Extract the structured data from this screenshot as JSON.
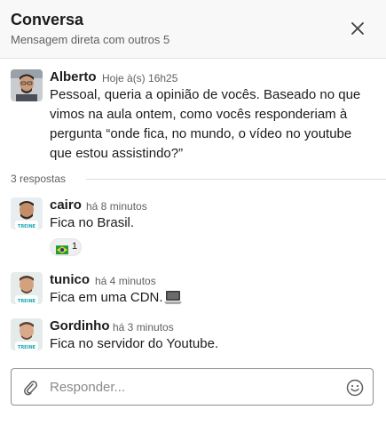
{
  "header": {
    "title": "Conversa",
    "subtitle": "Mensagem direta com outros 5",
    "close_icon": "close-icon"
  },
  "parent_message": {
    "author": "Alberto",
    "time": "Hoje à(s) 16h25",
    "text": "Pessoal, queria a opinião de vocês. Baseado no que vimos na aula ontem, como vocês responderiam à pergunta “onde fica, no mundo, o vídeo no youtube que estou assistindo?”"
  },
  "replies_label": "3 respostas",
  "replies": [
    {
      "author": "cairo",
      "time": "há 8 minutos",
      "text": "Fica no Brasil.",
      "reaction": {
        "emoji": "brazil-flag-icon",
        "count": "1"
      }
    },
    {
      "author": "tunico",
      "time": "há 4 minutos",
      "text": "Fica em uma CDN.",
      "emoji": "laptop-icon"
    },
    {
      "author": "Gordinho",
      "time": "há 3 minutos",
      "text": "Fica no servidor do Youtube."
    }
  ],
  "composer": {
    "placeholder": "Responder...",
    "value": ""
  },
  "colors": {
    "header_bg": "#f8f8f8",
    "muted_text": "#616061",
    "primary_text": "#1d1c1d"
  }
}
